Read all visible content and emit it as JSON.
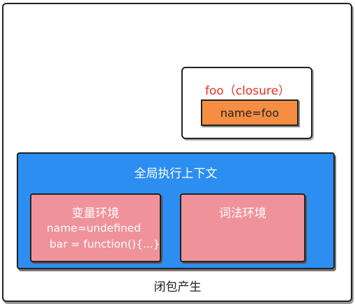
{
  "closure": {
    "title": "foo（closure）",
    "variable": "name=foo"
  },
  "global_context": {
    "title": "全局执行上下文",
    "variable_env": {
      "title": "变量环境",
      "lines": [
        "name=undefined",
        "bar = function(){...}"
      ]
    },
    "lexical_env": {
      "title": "词法环境"
    }
  },
  "caption": "闭包产生",
  "colors": {
    "closure_title": "#e0331f",
    "closure_var_fill": "#f58e42",
    "global_fill": "#2d8ef2",
    "env_fill": "#f0929a"
  }
}
